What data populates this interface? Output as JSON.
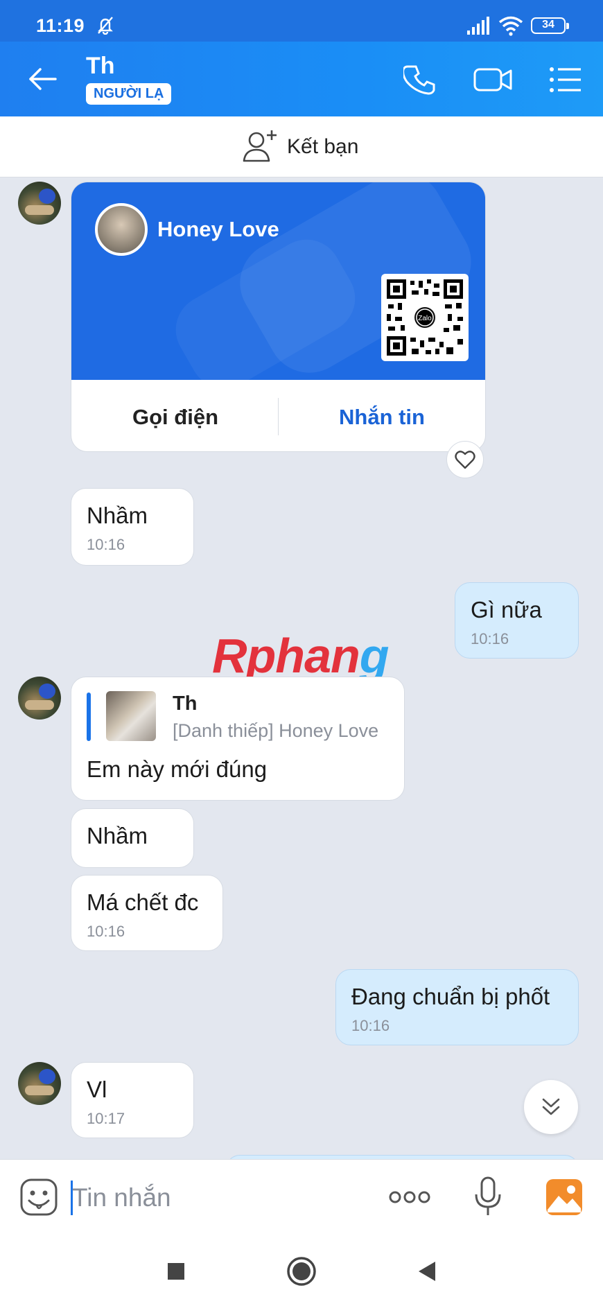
{
  "status_bar": {
    "time": "11:19",
    "battery": "34"
  },
  "header": {
    "contact_name": "Th",
    "badge": "NGƯỜI LẠ"
  },
  "friend_bar": {
    "label": "Kết bạn"
  },
  "card": {
    "name": "Honey Love",
    "call_label": "Gọi điện",
    "message_label": "Nhắn tin",
    "qr_label": "Zalo"
  },
  "messages": [
    {
      "side": "left",
      "text": "Nhầm",
      "time": "10:16"
    },
    {
      "side": "right",
      "text": "Gì nữa",
      "time": "10:16"
    },
    {
      "side": "left",
      "reply_name": "Th",
      "reply_desc": "[Danh thiếp] Honey Love",
      "text": "Em này mới đúng"
    },
    {
      "side": "left",
      "text": "Nhầm"
    },
    {
      "side": "left",
      "text": "Má chết đc",
      "time": "10:16"
    },
    {
      "side": "right",
      "text": "Đang chuẩn bị phốt",
      "time": "10:16"
    },
    {
      "side": "left",
      "text": "Vl",
      "time": "10:17"
    }
  ],
  "watermark": {
    "part1": "Rphan",
    "part2": "g"
  },
  "input": {
    "placeholder": "Tin nhắn"
  },
  "colors": {
    "primary": "#1f72e0",
    "my_bubble": "#d5ecfd",
    "background": "#e3e7ef"
  }
}
